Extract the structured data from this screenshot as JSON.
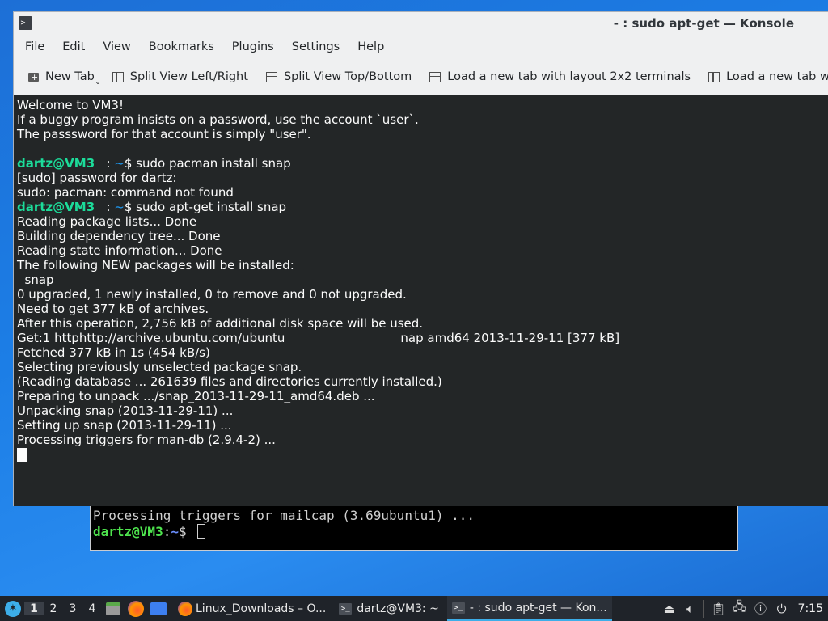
{
  "background_terminal": {
    "line1": "Processing triggers for mailcap (3.69ubuntu1) ...",
    "prompt_user": "dartz@VM3",
    "prompt_sep": ":",
    "prompt_path": "~",
    "prompt_symbol": "$ "
  },
  "window": {
    "title": "- : sudo apt-get — Konsole",
    "icon": "terminal-icon"
  },
  "menu": [
    "File",
    "Edit",
    "View",
    "Bookmarks",
    "Plugins",
    "Settings",
    "Help"
  ],
  "toolbar": {
    "new_tab": "New Tab",
    "split_lr": "Split View Left/Right",
    "split_tb": "Split View Top/Bottom",
    "layout_2x2": "Load a new tab with layout 2x2 terminals",
    "layout_more": "Load a new tab with lay"
  },
  "terminal": {
    "lines": [
      {
        "type": "text",
        "text": "Welcome to VM3!"
      },
      {
        "type": "text",
        "text": "If a buggy program insists on a password, use the account `user`."
      },
      {
        "type": "text",
        "text": "The passsword for that account is simply \"user\"."
      },
      {
        "type": "text",
        "text": ""
      },
      {
        "type": "prompt",
        "user": "dartz@VM3",
        "sep": "   : ",
        "path": "~",
        "cmd": "$ sudo pacman install snap"
      },
      {
        "type": "text",
        "text": "[sudo] password for dartz:"
      },
      {
        "type": "text",
        "text": "sudo: pacman: command not found"
      },
      {
        "type": "prompt",
        "user": "dartz@VM3",
        "sep": "   : ",
        "path": "~",
        "cmd": "$ sudo apt-get install snap"
      },
      {
        "type": "text",
        "text": "Reading package lists... Done"
      },
      {
        "type": "text",
        "text": "Building dependency tree... Done"
      },
      {
        "type": "text",
        "text": "Reading state information... Done"
      },
      {
        "type": "text",
        "text": "The following NEW packages will be installed:"
      },
      {
        "type": "text",
        "text": "  snap"
      },
      {
        "type": "text",
        "text": "0 upgraded, 1 newly installed, 0 to remove and 0 not upgraded."
      },
      {
        "type": "text",
        "text": "Need to get 377 kB of archives."
      },
      {
        "type": "text",
        "text": "After this operation, 2,756 kB of additional disk space will be used."
      },
      {
        "type": "text",
        "text": "Get:1 httphttp://archive.ubuntu.com/ubuntu                              nap amd64 2013-11-29-11 [377 kB]"
      },
      {
        "type": "text",
        "text": "Fetched 377 kB in 1s (454 kB/s)"
      },
      {
        "type": "text",
        "text": "Selecting previously unselected package snap."
      },
      {
        "type": "text",
        "text": "(Reading database ... 261639 files and directories currently installed.)"
      },
      {
        "type": "text",
        "text": "Preparing to unpack .../snap_2013-11-29-11_amd64.deb ..."
      },
      {
        "type": "text",
        "text": "Unpacking snap (2013-11-29-11) ..."
      },
      {
        "type": "text",
        "text": "Setting up snap (2013-11-29-11) ..."
      },
      {
        "type": "text",
        "text": "Processing triggers for man-db (2.9.4-2) ..."
      }
    ]
  },
  "taskbar": {
    "desktops": [
      "1",
      "2",
      "3",
      "4"
    ],
    "active_desktop": "1",
    "tasks": [
      {
        "label": "Linux_Downloads – O...",
        "icon": "firefox-icon"
      },
      {
        "label": "dartz@VM3: ~",
        "icon": "terminal-icon"
      },
      {
        "label": "- : sudo apt-get — Kon...",
        "icon": "terminal-icon",
        "active": true
      }
    ],
    "clock": "7:15"
  },
  "colors": {
    "desktop_bg": "#1c7ee6",
    "terminal_bg": "#232627",
    "prompt_user": "#1cdc9a",
    "prompt_path": "#1d99f3",
    "taskbar_bg": "#1f2329",
    "accent": "#3daee9"
  }
}
